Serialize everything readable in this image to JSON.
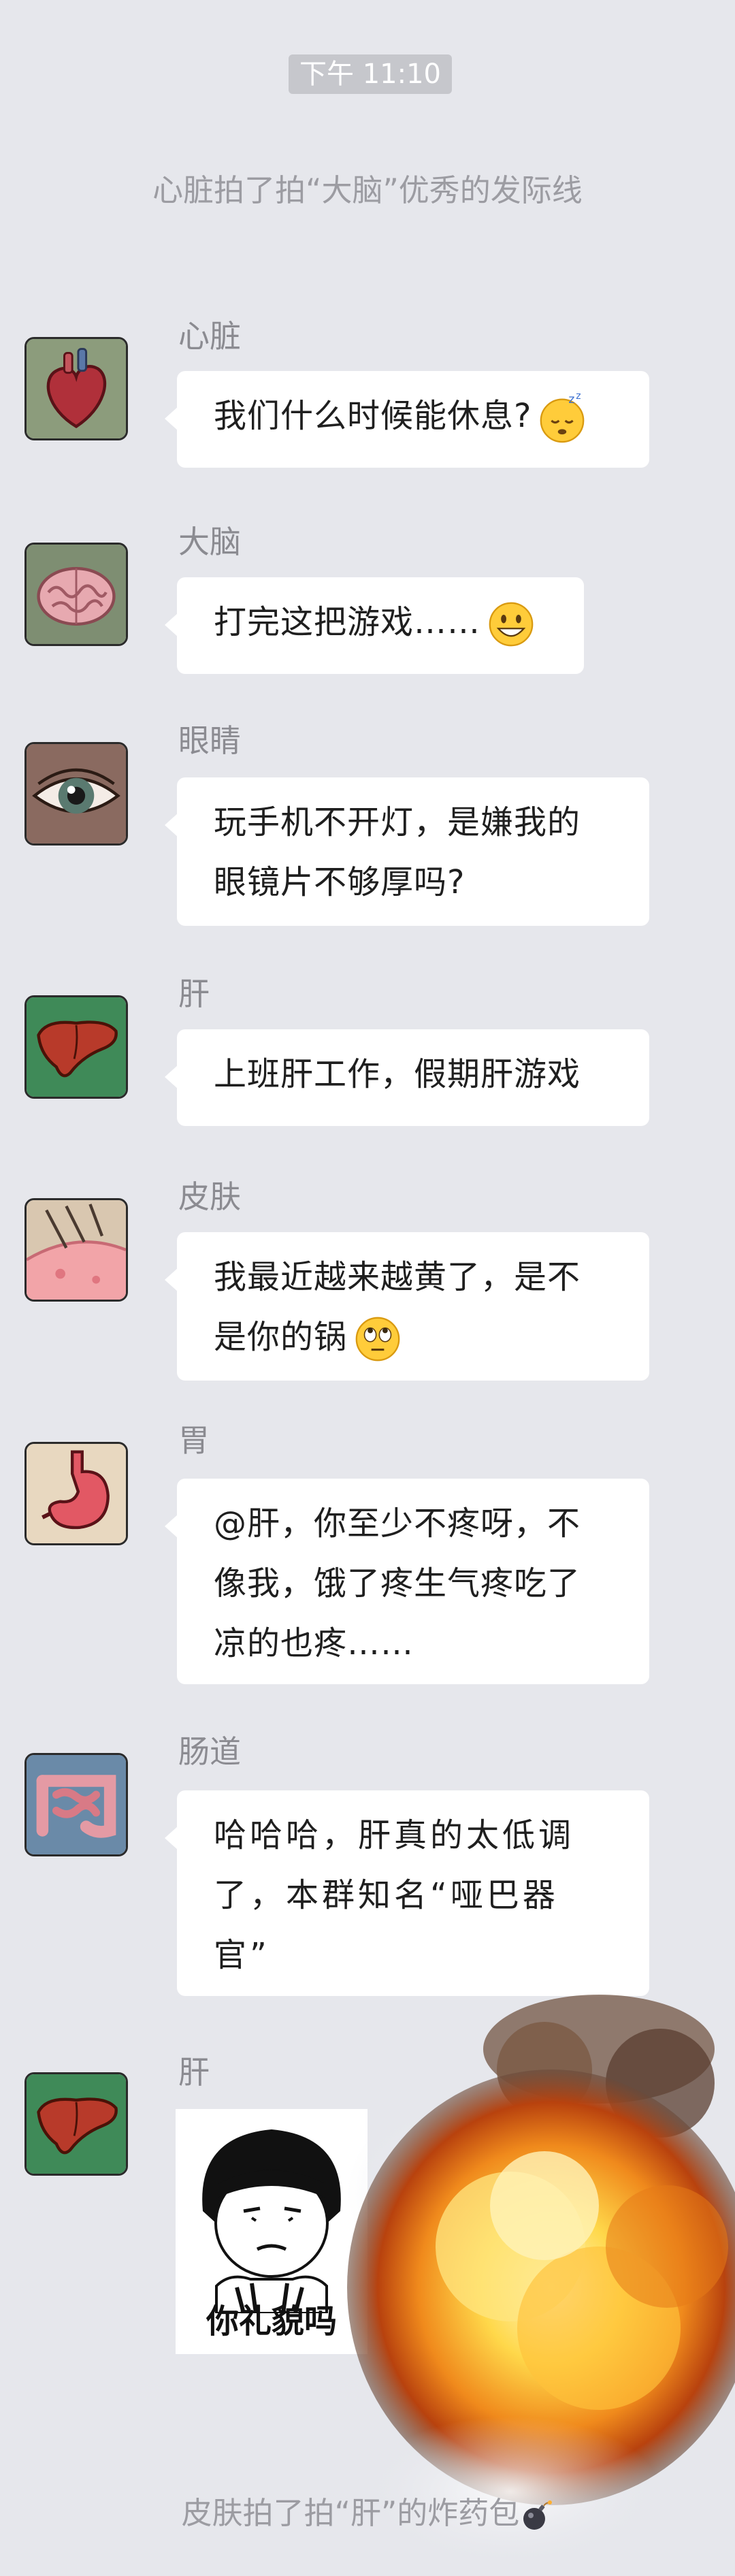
{
  "timestamp": "下午 11:10",
  "pat_top": "心脏拍了拍“大脑”优秀的发际线",
  "messages": [
    {
      "sender": "心脏",
      "lines": [
        "我们什么时候能休息?"
      ],
      "emoji": "sleepy-emoji"
    },
    {
      "sender": "大脑",
      "lines": [
        "打完这把游戏……"
      ],
      "emoji": "grin-emoji"
    },
    {
      "sender": "眼睛",
      "lines": [
        "玩手机不开灯，是嫌我的",
        "眼镜片不够厚吗?"
      ]
    },
    {
      "sender": "肝",
      "lines": [
        "上班肝工作，假期肝游戏"
      ]
    },
    {
      "sender": "皮肤",
      "lines": [
        "我最近越来越黄了，是不",
        "是你的锅"
      ],
      "emoji": "eye-roll-emoji"
    },
    {
      "sender": "胃",
      "lines": [
        "@肝，你至少不疼呀，不",
        "像我，饿了疼生气疼吃了",
        "凉的也疼……"
      ]
    },
    {
      "sender": "肠道",
      "lines": [
        "哈哈哈，肝真的太低调",
        "了，本群知名“哑巴器",
        "官”"
      ]
    },
    {
      "sender": "肝",
      "sticker_caption": "你礼貌吗"
    }
  ],
  "pat_bottom": "皮肤拍了拍“肝”的炸药包",
  "colors": {
    "background": "#e6e7ec",
    "bubble": "#ffffff",
    "sender": "#8b8b91",
    "system": "#9c9ca2"
  }
}
